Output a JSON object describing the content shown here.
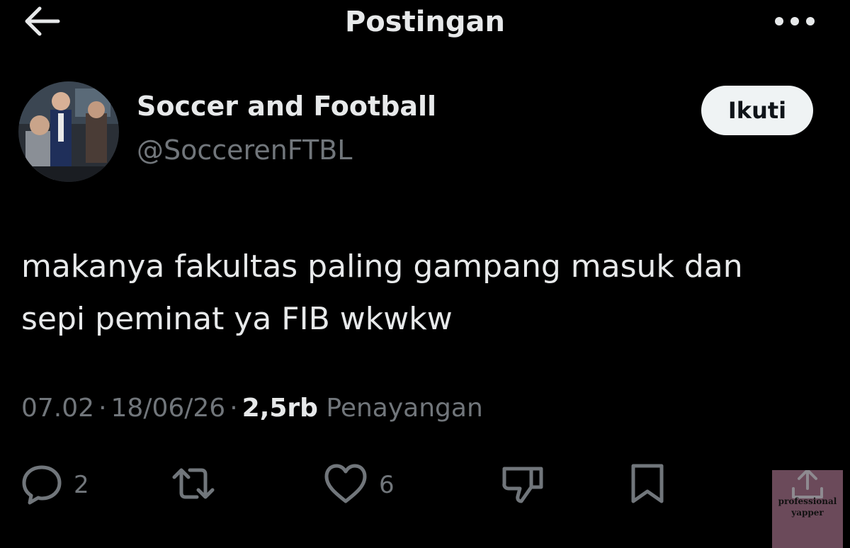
{
  "header": {
    "title": "Postingan",
    "back_icon": "arrow-left-icon",
    "more_icon": "more-horizontal-icon"
  },
  "author": {
    "name": "Soccer and Football",
    "handle": "@SoccerenFTBL",
    "follow_label": "Ikuti"
  },
  "tweet": {
    "text_line1": "makanya fakultas paling gampang masuk dan",
    "text_line2": "sepi peminat ya FIB wkwkw"
  },
  "meta": {
    "time": "07.02",
    "separator": "·",
    "date": "18/06/26",
    "views_count": "2,5rb",
    "views_label": "Penayangan"
  },
  "actions": {
    "reply_count": "2",
    "like_count": "6",
    "icons": [
      "reply-icon",
      "retweet-icon",
      "like-icon",
      "dislike-icon",
      "bookmark-icon",
      "share-icon"
    ]
  },
  "watermark": {
    "line1": "professional",
    "line2": "yapper"
  },
  "colors": {
    "background": "#000000",
    "text_primary": "#e7e9ea",
    "text_secondary": "#71767b",
    "follow_button_bg": "#eff3f4",
    "watermark_bg": "#6b4a5a"
  }
}
